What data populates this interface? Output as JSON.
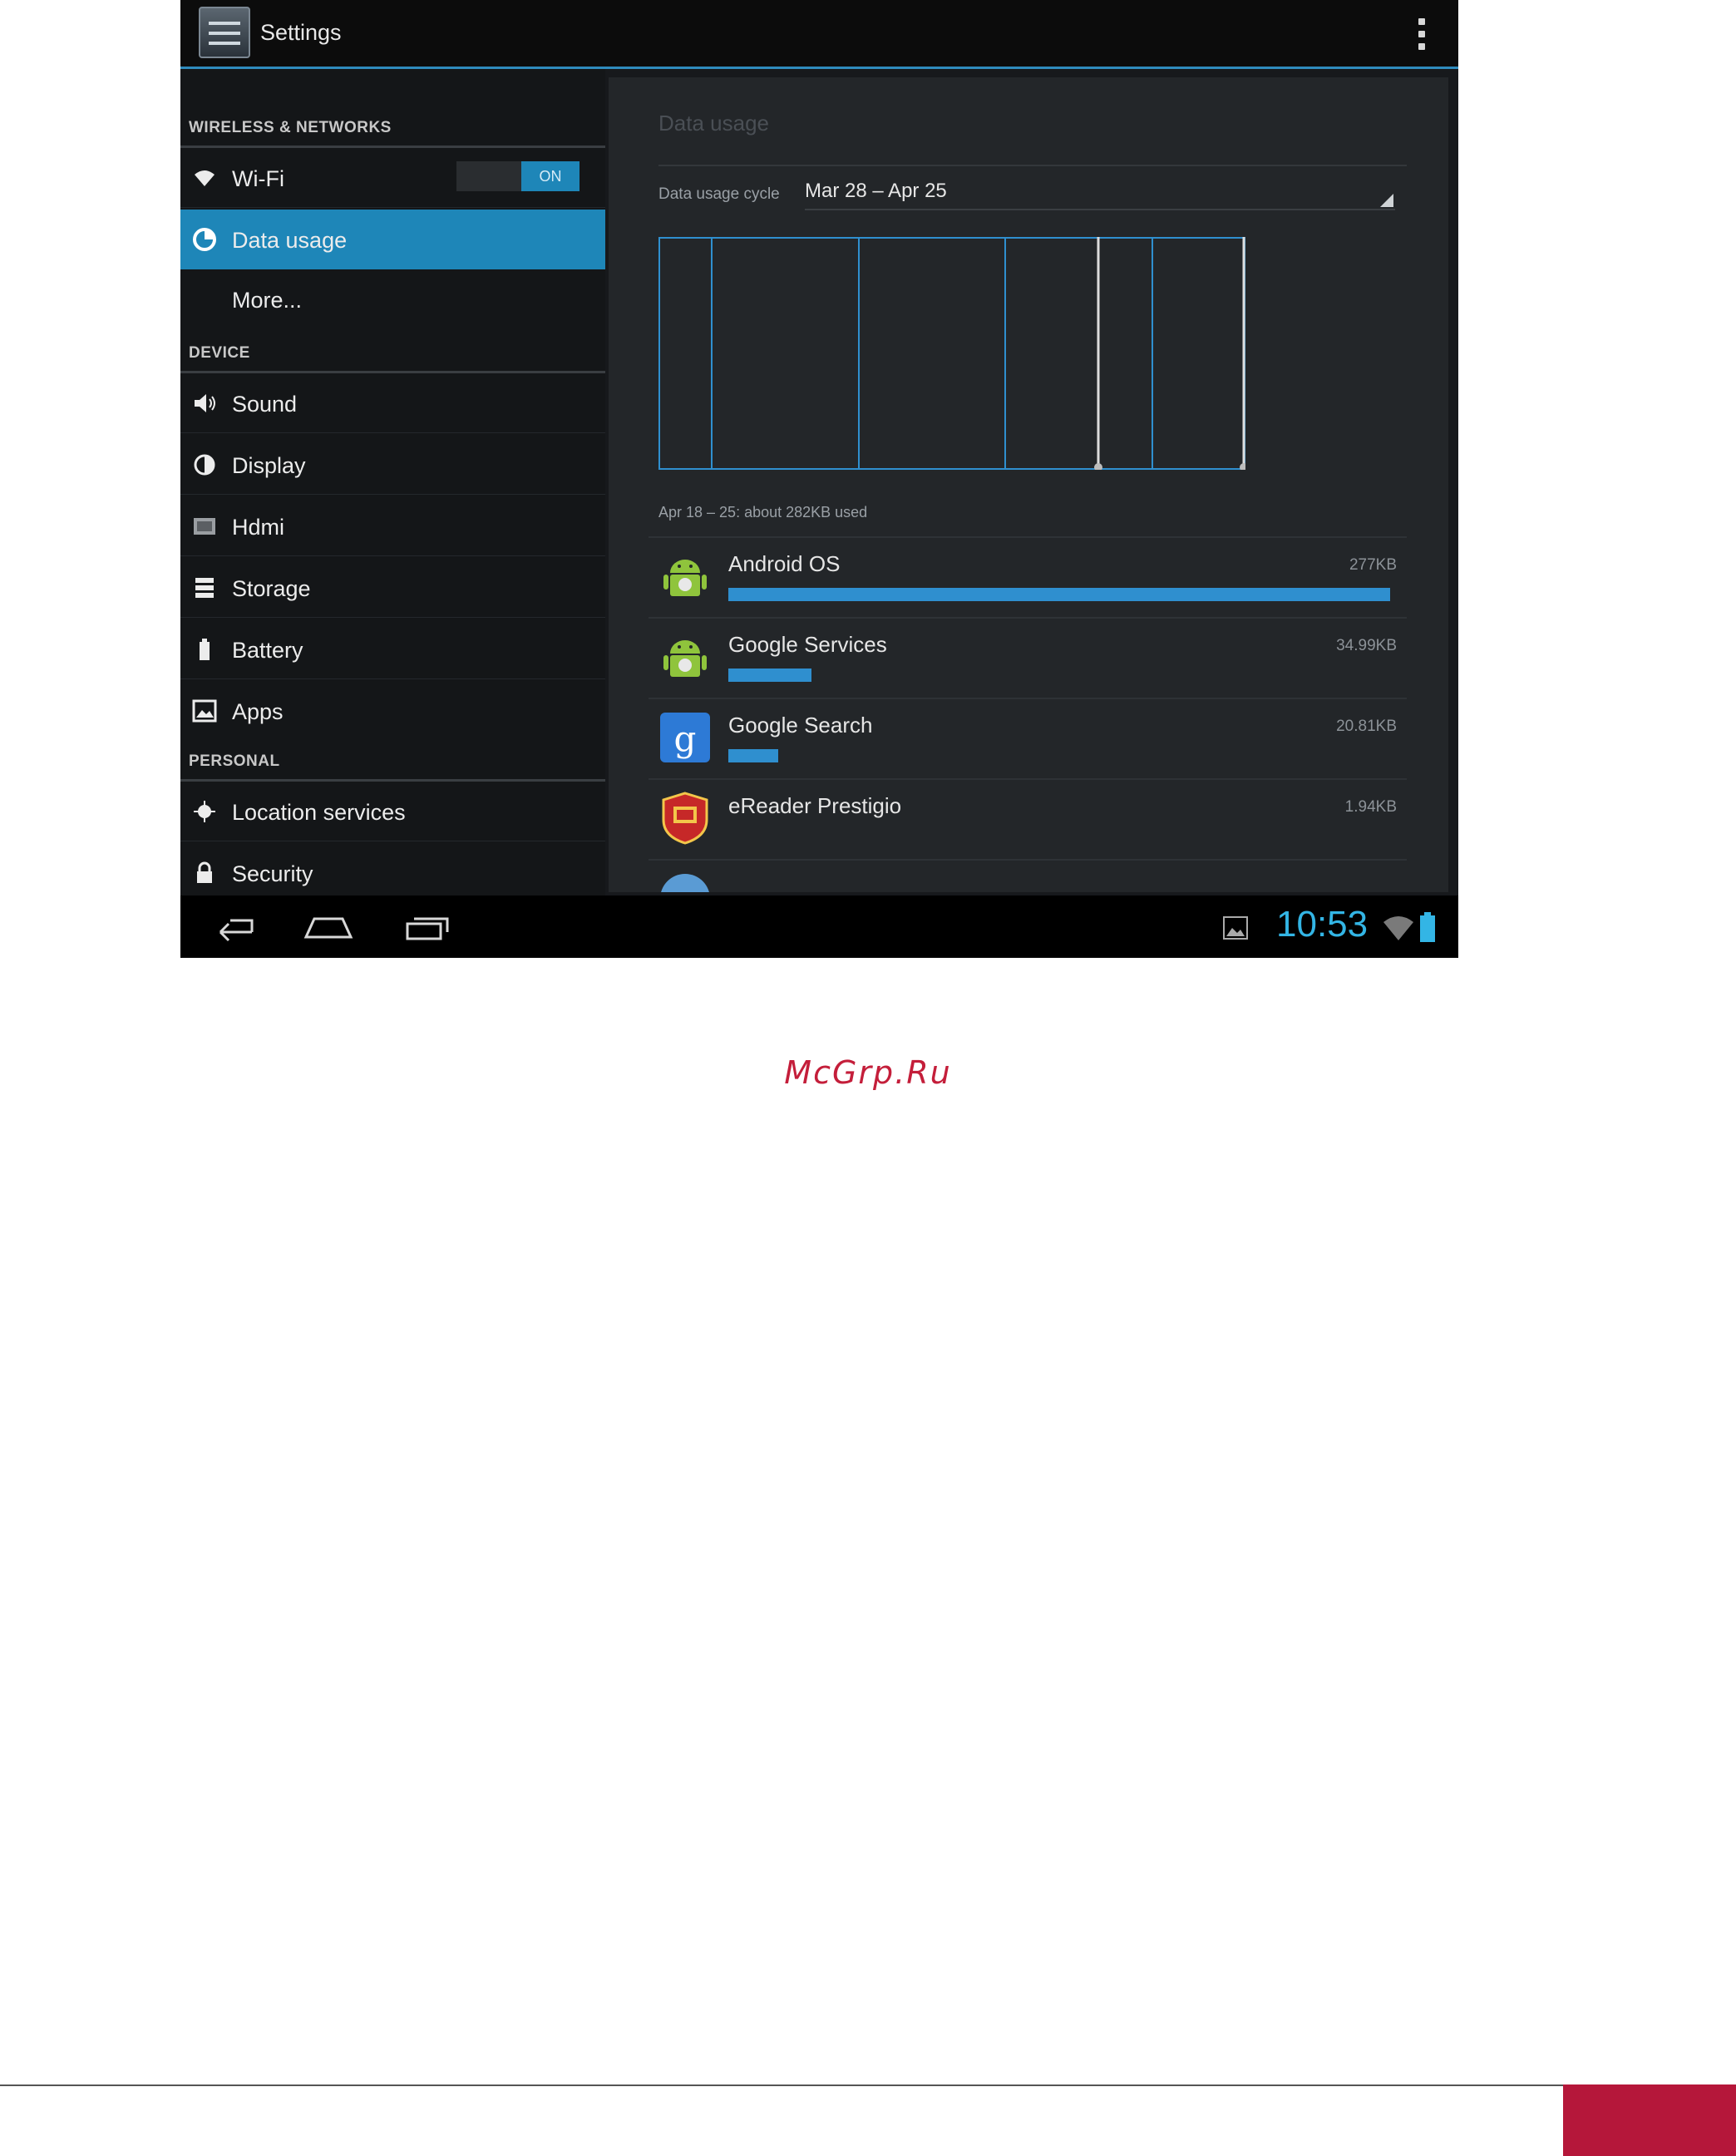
{
  "app": {
    "title": "Settings"
  },
  "sidebar": {
    "headers": {
      "wireless": "WIRELESS & NETWORKS",
      "device": "DEVICE",
      "personal": "PERSONAL"
    },
    "items": [
      {
        "label": "Wi-Fi",
        "icon": "wifi-icon",
        "toggle": "ON"
      },
      {
        "label": "Data usage",
        "icon": "data-usage-icon",
        "selected": true
      },
      {
        "label": "More...",
        "icon": ""
      },
      {
        "label": "Sound",
        "icon": "sound-icon"
      },
      {
        "label": "Display",
        "icon": "display-icon"
      },
      {
        "label": "Hdmi",
        "icon": "hdmi-icon"
      },
      {
        "label": "Storage",
        "icon": "storage-icon"
      },
      {
        "label": "Battery",
        "icon": "battery-icon"
      },
      {
        "label": "Apps",
        "icon": "apps-icon"
      },
      {
        "label": "Location services",
        "icon": "location-icon"
      },
      {
        "label": "Security",
        "icon": "lock-icon"
      }
    ]
  },
  "content": {
    "title": "Data usage",
    "cycle_label": "Data usage cycle",
    "cycle_value": "Mar 28 – Apr 25",
    "range_text": "Apr 18 – 25: about 282KB used",
    "apps": [
      {
        "name": "Android OS",
        "size": "277KB",
        "fraction": 1.0,
        "icon": "android-icon"
      },
      {
        "name": "Google Services",
        "size": "34.99KB",
        "fraction": 0.126,
        "icon": "android-icon"
      },
      {
        "name": "Google Search",
        "size": "20.81KB",
        "fraction": 0.075,
        "icon": "google-search-icon"
      },
      {
        "name": "eReader Prestigio",
        "size": "1.94KB",
        "fraction": 0.007,
        "icon": "ereader-icon"
      }
    ]
  },
  "statusbar": {
    "time": "10:53"
  },
  "colors": {
    "accent": "#33b5e5",
    "selected": "#1e86b8",
    "brand": "#c41e3a"
  },
  "watermark": "McGrp.Ru"
}
